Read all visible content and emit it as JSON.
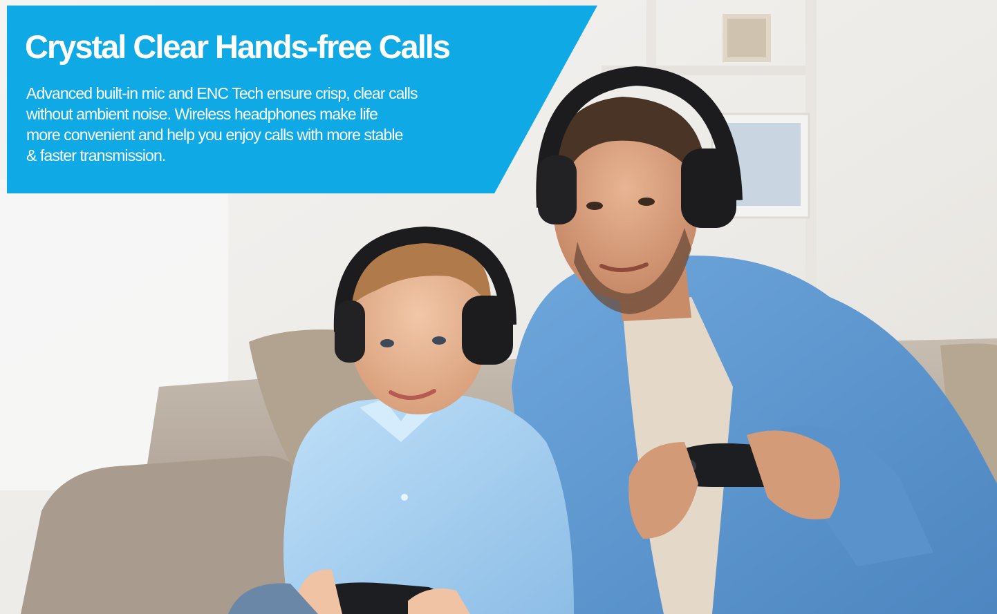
{
  "banner": {
    "title": "Crystal Clear Hands-free Calls",
    "body_lines": [
      "Advanced built-in mic and ENC Tech ensure crisp, clear calls",
      "without ambient noise. Wireless headphones make life",
      "more convenient and help you enjoy calls with more stable",
      "& faster transmission."
    ]
  },
  "colors": {
    "banner_blue": "#0fa9e6",
    "text": "#ffffff",
    "shirt_blue": "#5f9bd3",
    "kid_shirt": "#a9d2f3",
    "headphones": "#1c1c1e",
    "sofa": "#b6aa9c"
  },
  "icons": [
    "headphones-icon",
    "game-controller-icon"
  ]
}
